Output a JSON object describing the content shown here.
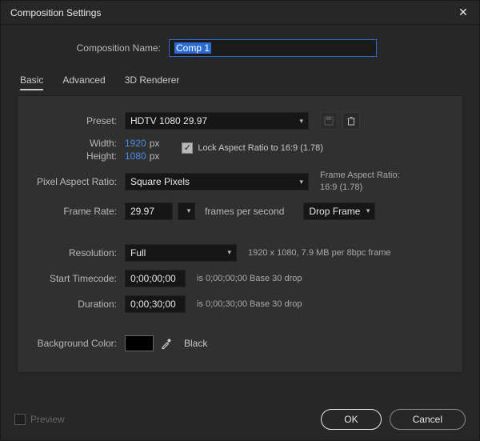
{
  "window": {
    "title": "Composition Settings"
  },
  "comp_name_label": "Composition Name:",
  "comp_name_value": "Comp 1",
  "tabs": {
    "basic": "Basic",
    "advanced": "Advanced",
    "renderer": "3D Renderer"
  },
  "preset": {
    "label": "Preset:",
    "value": "HDTV 1080 29.97"
  },
  "width": {
    "label": "Width:",
    "value": "1920",
    "suffix": "px"
  },
  "height": {
    "label": "Height:",
    "value": "1080",
    "suffix": "px"
  },
  "lock_aspect_label": "Lock Aspect Ratio to 16:9 (1.78)",
  "pixel_aspect": {
    "label": "Pixel Aspect Ratio:",
    "value": "Square Pixels"
  },
  "frame_ratio": {
    "label": "Frame Aspect Ratio:",
    "value": "16:9 (1.78)"
  },
  "frame_rate": {
    "label": "Frame Rate:",
    "value": "29.97",
    "fps_label": "frames per second",
    "drop": "Drop Frame"
  },
  "resolution": {
    "label": "Resolution:",
    "value": "Full",
    "info": "1920 x 1080, 7.9 MB per 8bpc frame"
  },
  "start_tc": {
    "label": "Start Timecode:",
    "value": "0;00;00;00",
    "info": "is 0;00;00;00  Base 30  drop"
  },
  "duration": {
    "label": "Duration:",
    "value": "0;00;30;00",
    "info": "is 0;00;30;00  Base 30  drop"
  },
  "bgcolor": {
    "label": "Background Color:",
    "name": "Black",
    "hex": "#000000"
  },
  "footer": {
    "preview": "Preview",
    "ok": "OK",
    "cancel": "Cancel"
  }
}
